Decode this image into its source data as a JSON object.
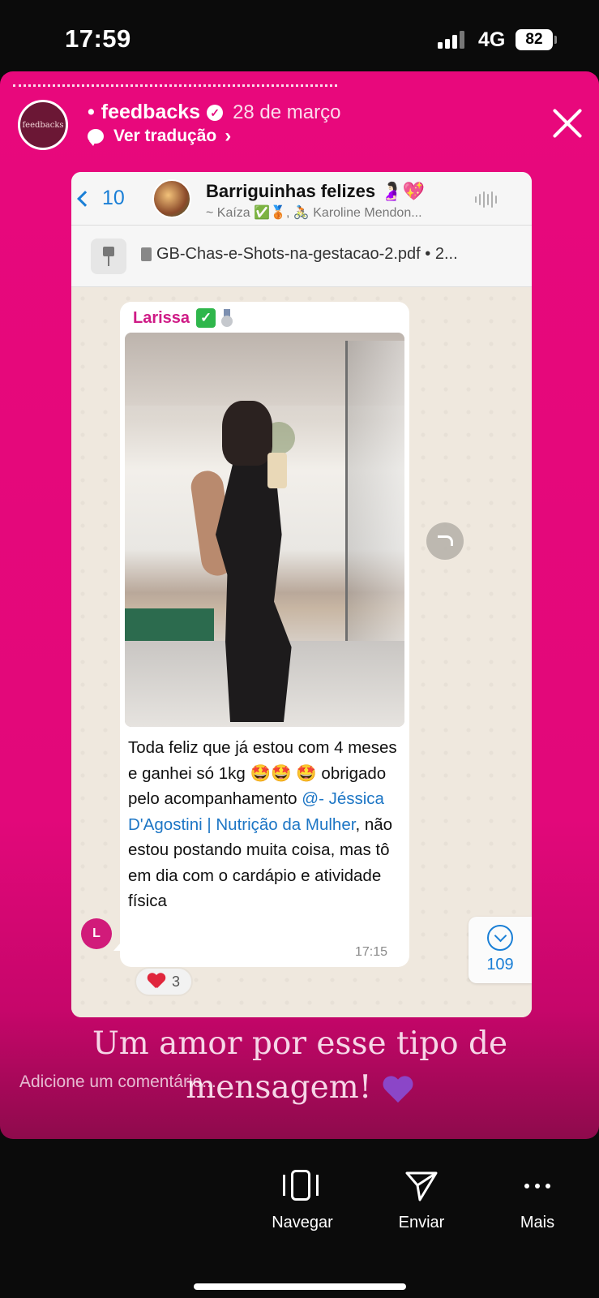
{
  "status_bar": {
    "time": "17:59",
    "network": "4G",
    "battery": "82"
  },
  "story": {
    "avatar_text": "feedbacks",
    "username": "feedbacks",
    "date": "28 de março",
    "translate_label": "Ver tradução",
    "caption": "Um amor por esse tipo de mensagem!",
    "comment_placeholder": "Adicione um comentário..."
  },
  "whatsapp": {
    "back_count": "10",
    "group_name": "Barriguinhas felizes 🤰🏻💖",
    "group_members": "~ Kaíza ✅🥉, 🚴🏻 Karoline Mendon...",
    "pinned_file": "GB-Chas-e-Shots-na-gestacao-2.pdf • 2...",
    "message": {
      "sender": "Larissa",
      "text_before": "Toda feliz que já estou com 4 meses e ganhei só 1kg 🤩🤩 🤩 obrigado pelo acompanhamento ",
      "mention": "@- Jéssica D'Agostini | Nutrição da Mulher",
      "text_after": ", não estou postando muita coisa, mas tô em dia com o cardápio e atividade física",
      "time": "17:15",
      "avatar_letter": "L",
      "reaction_count": "3"
    },
    "unread_count": "109"
  },
  "actions": [
    {
      "label": "Navegar",
      "icon": "navigate-icon"
    },
    {
      "label": "Enviar",
      "icon": "send-icon"
    },
    {
      "label": "Mais",
      "icon": "more-icon"
    }
  ],
  "colors": {
    "story_bg": "#e2087a",
    "sender": "#cf1b86",
    "mention": "#1d76c5",
    "wa_bg": "#efe8de"
  }
}
